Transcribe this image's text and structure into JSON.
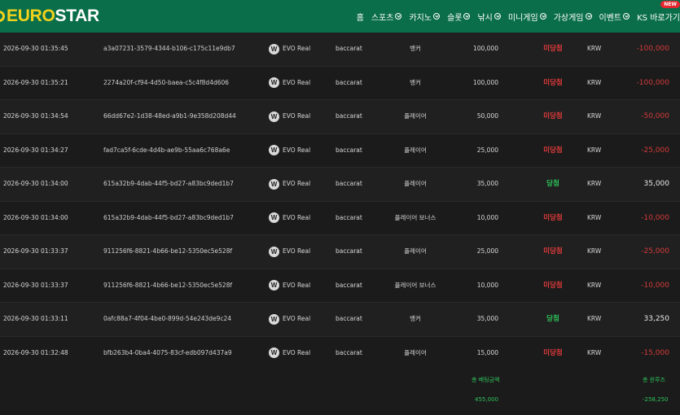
{
  "header": {
    "logo_euro": "EURO",
    "logo_star": "STAR",
    "nav": [
      {
        "label": "홈",
        "chevron": false
      },
      {
        "label": "스포츠",
        "chevron": true
      },
      {
        "label": "카지노",
        "chevron": true
      },
      {
        "label": "슬롯",
        "chevron": true
      },
      {
        "label": "낚시",
        "chevron": true
      },
      {
        "label": "미니게임",
        "chevron": true
      },
      {
        "label": "가상게임",
        "chevron": true
      },
      {
        "label": "이벤트",
        "chevron": true
      },
      {
        "label": "KS 바로가기",
        "chevron": false
      }
    ],
    "new_badge": "NEW"
  },
  "rows": [
    {
      "date": "2026-09-30 01:35:45",
      "id": "a3a07231-3579-4344-b106-c175c11e9db7",
      "provider_icon": "W",
      "provider": "EVO Real",
      "game": "baccarat",
      "bet": "뱅커",
      "amount": "100,000",
      "result": "미당첨",
      "result_type": "lose",
      "currency": "KRW",
      "win": "-100,000",
      "win_type": "neg"
    },
    {
      "date": "2026-09-30 01:35:21",
      "id": "2274a20f-cf94-4d50-baea-c5c4f8d4d606",
      "provider_icon": "W",
      "provider": "EVO Real",
      "game": "baccarat",
      "bet": "뱅커",
      "amount": "100,000",
      "result": "미당첨",
      "result_type": "lose",
      "currency": "KRW",
      "win": "-100,000",
      "win_type": "neg"
    },
    {
      "date": "2026-09-30 01:34:54",
      "id": "66dd67e2-1d38-48ed-a9b1-9e358d208d44",
      "provider_icon": "W",
      "provider": "EVO Real",
      "game": "baccarat",
      "bet": "플레이어",
      "amount": "50,000",
      "result": "미당첨",
      "result_type": "lose",
      "currency": "KRW",
      "win": "-50,000",
      "win_type": "neg"
    },
    {
      "date": "2026-09-30 01:34:27",
      "id": "fad7ca5f-6cde-4d4b-ae9b-55aa6c768a6e",
      "provider_icon": "W",
      "provider": "EVO Real",
      "game": "baccarat",
      "bet": "플레이어",
      "amount": "25,000",
      "result": "미당첨",
      "result_type": "lose",
      "currency": "KRW",
      "win": "-25,000",
      "win_type": "neg"
    },
    {
      "date": "2026-09-30 01:34:00",
      "id": "615a32b9-4dab-44f5-bd27-a83bc9ded1b7",
      "provider_icon": "W",
      "provider": "EVO Real",
      "game": "baccarat",
      "bet": "플레이어",
      "amount": "35,000",
      "result": "당첨",
      "result_type": "win",
      "currency": "KRW",
      "win": "35,000",
      "win_type": "pos"
    },
    {
      "date": "2026-09-30 01:34:00",
      "id": "615a32b9-4dab-44f5-bd27-a83bc9ded1b7",
      "provider_icon": "W",
      "provider": "EVO Real",
      "game": "baccarat",
      "bet": "플레이어 보너스",
      "amount": "10,000",
      "result": "미당첨",
      "result_type": "lose",
      "currency": "KRW",
      "win": "-10,000",
      "win_type": "neg"
    },
    {
      "date": "2026-09-30 01:33:37",
      "id": "911256f6-8821-4b66-be12-5350ec5e528f",
      "provider_icon": "W",
      "provider": "EVO Real",
      "game": "baccarat",
      "bet": "플레이어",
      "amount": "25,000",
      "result": "미당첨",
      "result_type": "lose",
      "currency": "KRW",
      "win": "-25,000",
      "win_type": "neg"
    },
    {
      "date": "2026-09-30 01:33:37",
      "id": "911256f6-8821-4b66-be12-5350ec5e528f",
      "provider_icon": "W",
      "provider": "EVO Real",
      "game": "baccarat",
      "bet": "플레이어 보너스",
      "amount": "10,000",
      "result": "미당첨",
      "result_type": "lose",
      "currency": "KRW",
      "win": "-10,000",
      "win_type": "neg"
    },
    {
      "date": "2026-09-30 01:33:11",
      "id": "0afc88a7-4f04-4be0-899d-54e243de9c24",
      "provider_icon": "W",
      "provider": "EVO Real",
      "game": "baccarat",
      "bet": "뱅커",
      "amount": "35,000",
      "result": "당첨",
      "result_type": "win",
      "currency": "KRW",
      "win": "33,250",
      "win_type": "pos"
    },
    {
      "date": "2026-09-30 01:32:48",
      "id": "bfb263b4-0ba4-4075-83cf-edb097d437a9",
      "provider_icon": "W",
      "provider": "EVO Real",
      "game": "baccarat",
      "bet": "플레이어",
      "amount": "15,000",
      "result": "미당첨",
      "result_type": "lose",
      "currency": "KRW",
      "win": "-15,000",
      "win_type": "neg"
    }
  ],
  "totals": {
    "bet_label": "총 베팅금액",
    "bet_value": "455,000",
    "win_label": "총 윈루즈",
    "win_value": "-258,250"
  },
  "colors": {
    "header_bg": "#0a6e4a",
    "logo_yellow": "#f2d21b",
    "lose_red": "#e03a3a",
    "win_green": "#2ec45a"
  }
}
